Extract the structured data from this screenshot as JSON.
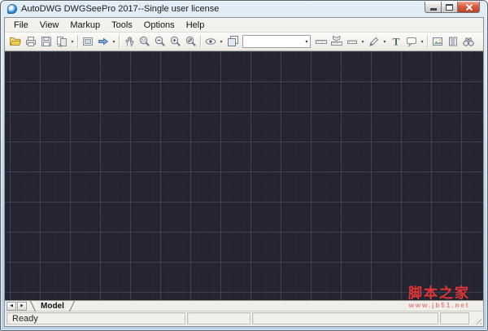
{
  "window": {
    "title": "AutoDWG DWGSeePro 2017--Single user license",
    "logo_icon": "autodwg-logo-icon",
    "controls": [
      "minimize",
      "maximize",
      "close"
    ]
  },
  "menu": {
    "items": [
      "File",
      "View",
      "Markup",
      "Tools",
      "Options",
      "Help"
    ]
  },
  "toolbar": {
    "dropdown_glyph": "▾",
    "text_tool_glyph": "T",
    "combo_value": "",
    "icons": [
      "open-folder",
      "print",
      "save",
      "convert",
      "fit-screen",
      "forward-arrow",
      "pan-hand",
      "zoom-window",
      "zoom-out",
      "zoom-in",
      "zoom-extents",
      "visibility-eye",
      "layers",
      "measure-distance",
      "measure-area",
      "measure-angle",
      "markup-pen",
      "text-tool",
      "callout",
      "export-image",
      "compare",
      "find-binoculars"
    ]
  },
  "canvas": {
    "background": "#252532",
    "grid_color": "#3b3b50",
    "watermark": {
      "line1": "脚本之家",
      "line2": "www.jb51.net",
      "color": "#e13434"
    }
  },
  "tabbar": {
    "prev_glyph": "◀",
    "next_glyph": "▶",
    "model_label": "Model"
  },
  "statusbar": {
    "ready": "Ready"
  }
}
